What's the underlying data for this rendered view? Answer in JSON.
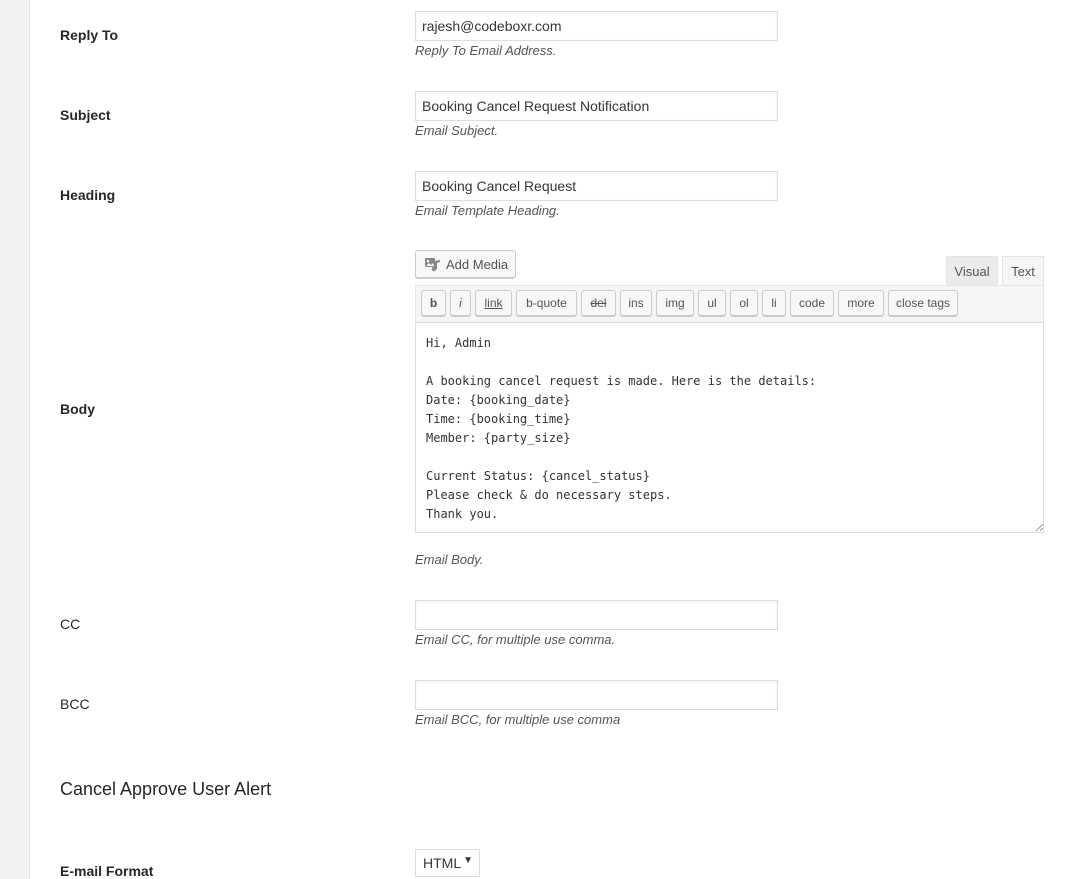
{
  "fields": {
    "reply_to": {
      "label": "Reply To",
      "value": "rajesh@codeboxr.com",
      "description": "Reply To Email Address."
    },
    "subject": {
      "label": "Subject",
      "value": "Booking Cancel Request Notification",
      "description": "Email Subject."
    },
    "heading": {
      "label": "Heading",
      "value": "Booking Cancel Request",
      "description": "Email Template Heading."
    },
    "body": {
      "label": "Body",
      "description": "Email Body."
    },
    "cc": {
      "label": "CC",
      "value": "",
      "description": "Email CC, for multiple use comma."
    },
    "bcc": {
      "label": "BCC",
      "value": "",
      "description": "Email BCC, for multiple use comma"
    }
  },
  "editor": {
    "add_media_label": "Add Media",
    "media_icon": "add-media-icon",
    "tabs": {
      "visual": "Visual",
      "text": "Text",
      "active": "Text"
    },
    "quicktags": [
      "b",
      "i",
      "link",
      "b-quote",
      "del",
      "ins",
      "img",
      "ul",
      "ol",
      "li",
      "code",
      "more",
      "close tags"
    ],
    "content": "Hi, Admin\n\nA booking cancel request is made. Here is the details:\nDate: {booking_date}\nTime: {booking_time}\nMember: {party_size}\n\nCurrent Status: {cancel_status}\nPlease check & do necessary steps.\nThank you."
  },
  "section": {
    "title": "Cancel Approve User Alert"
  },
  "email_format": {
    "label": "E-mail Format",
    "selected": "HTML"
  }
}
